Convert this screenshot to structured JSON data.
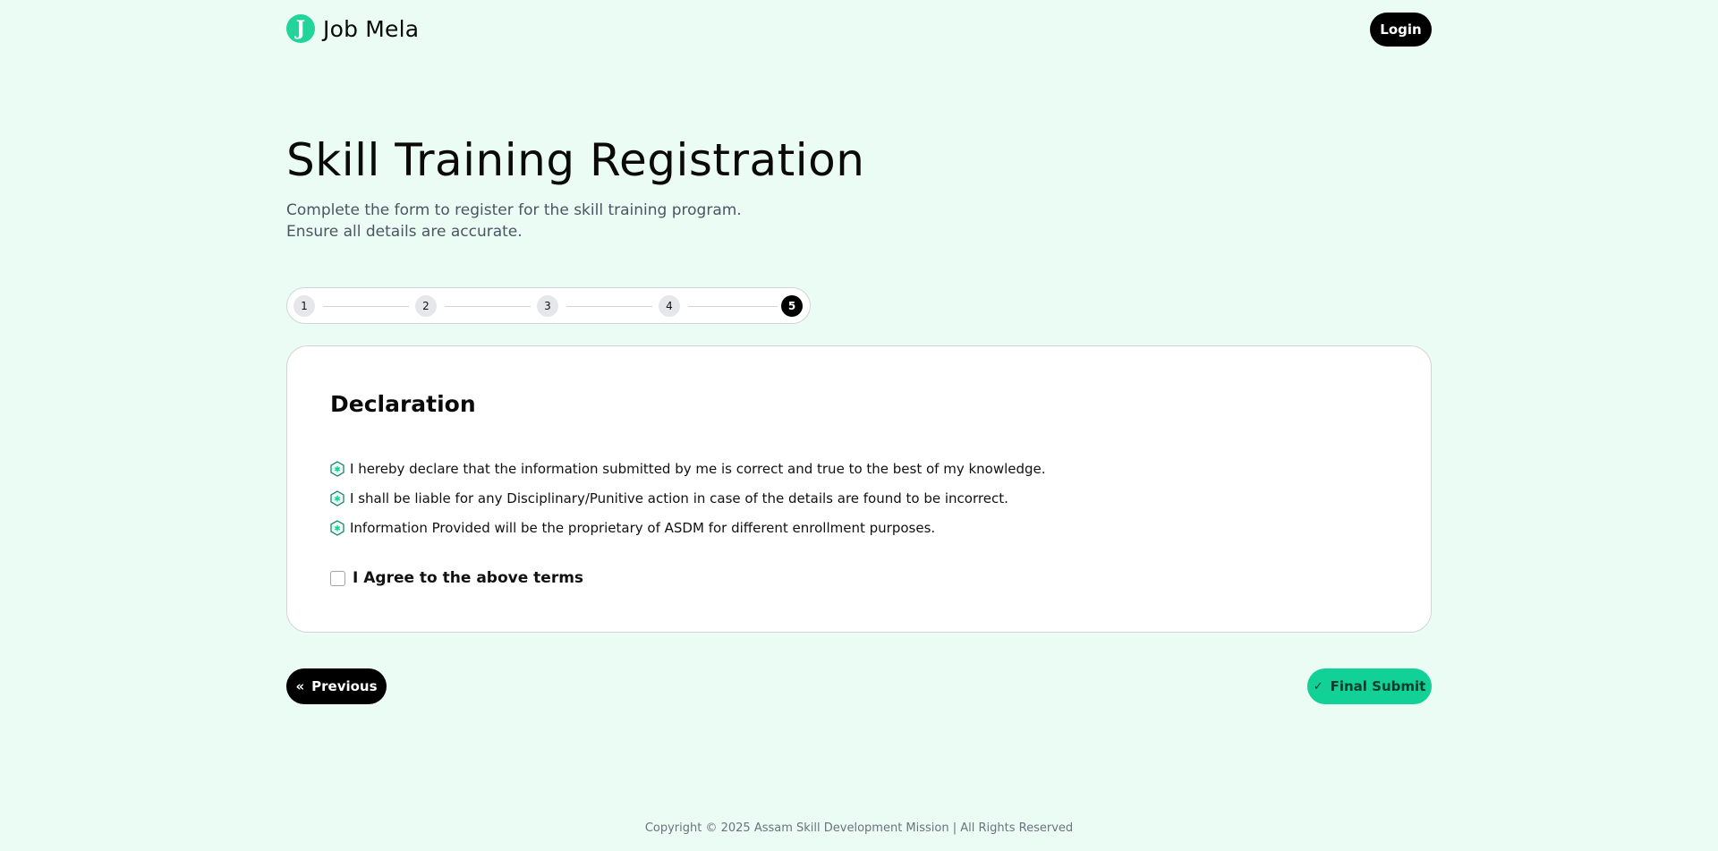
{
  "header": {
    "logo_letter": "J",
    "brand": "Job Mela",
    "login_label": "Login"
  },
  "page": {
    "title": "Skill Training Registration",
    "subtitle_line1": "Complete the form to register for the skill training program.",
    "subtitle_line2": "Ensure all details are accurate."
  },
  "stepper": {
    "steps": [
      "1",
      "2",
      "3",
      "4",
      "5"
    ],
    "active_step": 5
  },
  "declaration": {
    "title": "Declaration",
    "items": [
      "I hereby declare that the information submitted by me is correct and true to the best of my knowledge.",
      "I shall be liable for any Disciplinary/Punitive action in case of the details are found to be incorrect.",
      "Information Provided will be the proprietary of ASDM for different enrollment purposes."
    ],
    "agree_label": "I Agree to the above terms",
    "agree_checked": false
  },
  "actions": {
    "previous_label": "Previous",
    "previous_icon": "double-chevron-left-icon",
    "submit_label": "Final Submit",
    "submit_icon": "check-icon"
  },
  "footer": {
    "copyright": "Copyright © 2025 Assam Skill Development Mission | All Rights Reserved"
  },
  "colors": {
    "background": "#eafcf3",
    "accent": "#12d196",
    "logo": "#22d39a",
    "dark": "#000000"
  }
}
